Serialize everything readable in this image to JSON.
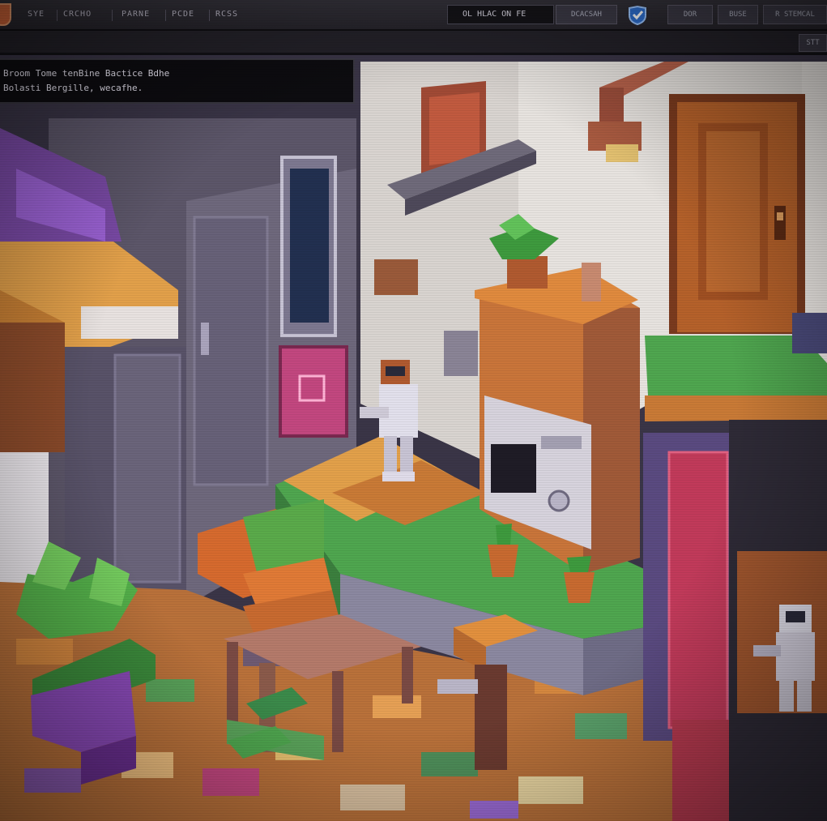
{
  "window": {
    "menu": [
      "SYE",
      "CRCHO",
      "PARNE",
      "PCDE",
      "RCSS"
    ],
    "search_value": "OL HLAC ON FE",
    "search_button": "DCACSAH",
    "right_buttons": [
      "DOR",
      "BUSE",
      "R STEMCAL"
    ],
    "sub_button": "STT"
  },
  "dialog": {
    "line1": "Broom Tome tenBine Bactice Bdhe",
    "line2": "Bolasti Bergille, wecafhe."
  },
  "colors": {
    "wall": "#e7e3df",
    "floor_orange": "#c8753a",
    "green": "#4fa64f",
    "purple": "#7a4aa6",
    "door": "#b5612a"
  }
}
